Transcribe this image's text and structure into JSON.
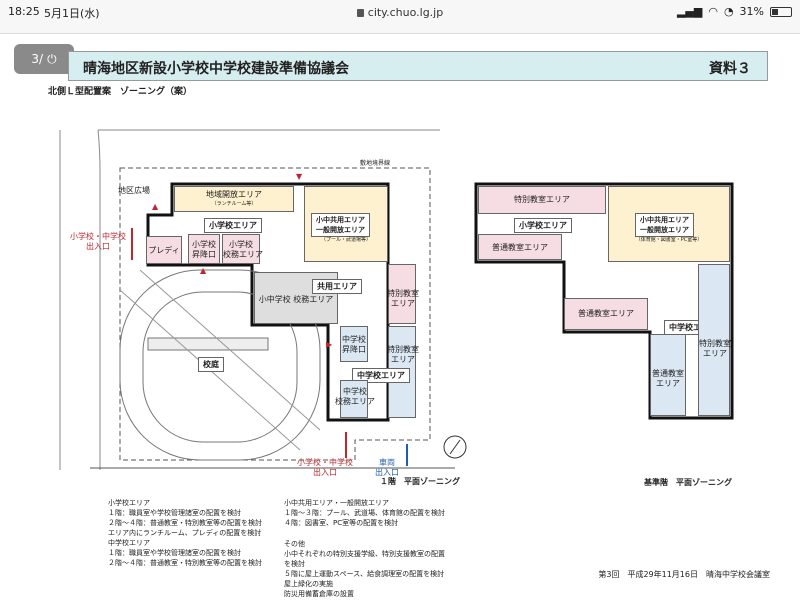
{
  "status_bar": {
    "time": "18:25",
    "date": "5月1日(水)",
    "url": "city.chuo.lg.jp",
    "battery": "31%",
    "battery_level": 0.31
  },
  "page_indicator": "3/",
  "header": {
    "title": "晴海地区新設小学校中学校建設準備協議会",
    "doc_label": "資料３"
  },
  "subtitle": "北側Ｌ型配置案　ゾーニング（案）",
  "plan1": {
    "site_boundary_label": "敷地境界線",
    "regional_plaza": "地区広場",
    "community_area": "地域開放エリア",
    "community_area_sub": "（ランチルーム等）",
    "elem_area": "小学校エリア",
    "shared_area_title": "小中共用エリア\n一般開放エリア",
    "shared_area_sub": "（プール・武道場等）",
    "predi": "プレディ",
    "elem_entrance": "小学校\n昇降口",
    "elem_office": "小学校\n校務エリア",
    "common_area": "共用エリア",
    "elem_common_office": "小中学校 校務エリア",
    "special_room_1": "特別教室\nエリア",
    "special_room_2": "特別教室\nエリア",
    "jhs_entrance": "中学校\n昇降口",
    "jhs_area": "中学校エリア",
    "jhs_office": "中学校\n校務エリア",
    "courtyard": "校庭",
    "side_entrance": "小学校・中学校\n出入口",
    "bottom_entrance": "小学校・中学校\n出入口",
    "vehicle_entrance": "車両\n出入口",
    "caption": "１階　平面ゾーニング"
  },
  "plan2": {
    "special_room": "特別教室エリア",
    "elem_area": "小学校エリア",
    "shared_area_title": "小中共用エリア\n一般開放エリア",
    "shared_area_sub": "（体育館・図書室・PC室等）",
    "general_room_1": "普通教室エリア",
    "general_room_2": "普通教室エリア",
    "jhs_area": "中学校エリア",
    "general_room_3": "普通教室\nエリア",
    "special_room_3": "特別教室\nエリア",
    "caption": "基準階　平面ゾーニング"
  },
  "notes": {
    "elem": "小学校エリア\n１階：職員室や学校管理諸室の配置を検討\n２階〜４階：普通教室・特別教室等の配置を検討\nエリア内にランチルーム、プレディの配置を検討",
    "jhs": "中学校エリア\n１階：職員室や学校管理諸室の配置を検討\n２階〜４階：普通教室・特別教室等の配置を検討",
    "shared": "小中共用エリア・一般開放エリア\n１階〜３階：プール、武道場、体育館の配置を検討\n４階：図書室、PC室等の配置を検討\n\nその他\n小中それぞれの特別支援学級、特別支援教室の配置\nを検討\n５階に屋上運動スペース、給食調理室の配置を検討\n屋上緑化の実施\n防災用備蓄倉庫の設置"
  },
  "footer": "第3回　平成29年11月16日　晴海中学校会議室",
  "colors": {
    "accent_red": "#c0262d",
    "accent_blue": "#1f5ea8",
    "banner_bg": "#d7eef0"
  }
}
